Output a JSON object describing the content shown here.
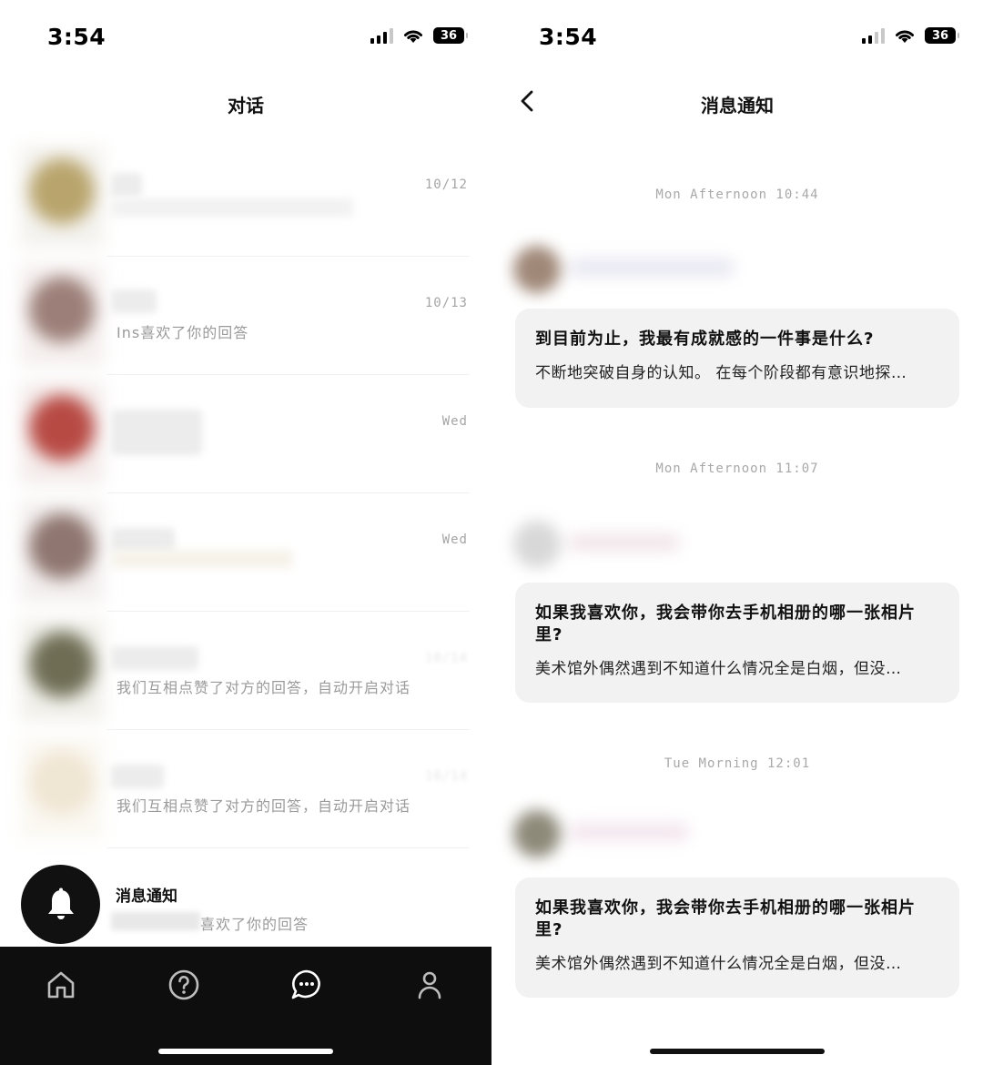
{
  "left": {
    "status": {
      "time": "3:54",
      "battery": "36"
    },
    "header": {
      "title": "对话"
    },
    "conversations": [
      {
        "date": "10/12",
        "preview": ""
      },
      {
        "date": "10/13",
        "preview": "Ins喜欢了你的回答"
      },
      {
        "date": "Wed",
        "preview": ""
      },
      {
        "date": "Wed",
        "preview": ""
      },
      {
        "date": "",
        "preview": "我们互相点赞了对方的回答，自动开启对话"
      },
      {
        "date": "",
        "preview": "我们互相点赞了对方的回答，自动开启对话"
      }
    ],
    "notification": {
      "title": "消息通知",
      "subtitle": "喜欢了你的回答"
    },
    "tabs": [
      {
        "icon": "home-icon"
      },
      {
        "icon": "question-icon"
      },
      {
        "icon": "chat-icon"
      },
      {
        "icon": "profile-icon"
      }
    ]
  },
  "right": {
    "status": {
      "time": "3:54",
      "battery": "36"
    },
    "header": {
      "title": "消息通知"
    },
    "messages": [
      {
        "time": "Mon Afternoon 10:44",
        "question": "到目前为止，我最有成就感的一件事是什么?",
        "answer": "不断地突破自身的认知。 在每个阶段都有意识地探…"
      },
      {
        "time": "Mon Afternoon 11:07",
        "question": "如果我喜欢你，我会带你去手机相册的哪一张相片里?",
        "answer": "美术馆外偶然遇到不知道什么情况全是白烟，但没…"
      },
      {
        "time": "Tue Morning 12:01",
        "question": "如果我喜欢你，我会带你去手机相册的哪一张相片里?",
        "answer": "美术馆外偶然遇到不知道什么情况全是白烟，但没…"
      }
    ]
  }
}
